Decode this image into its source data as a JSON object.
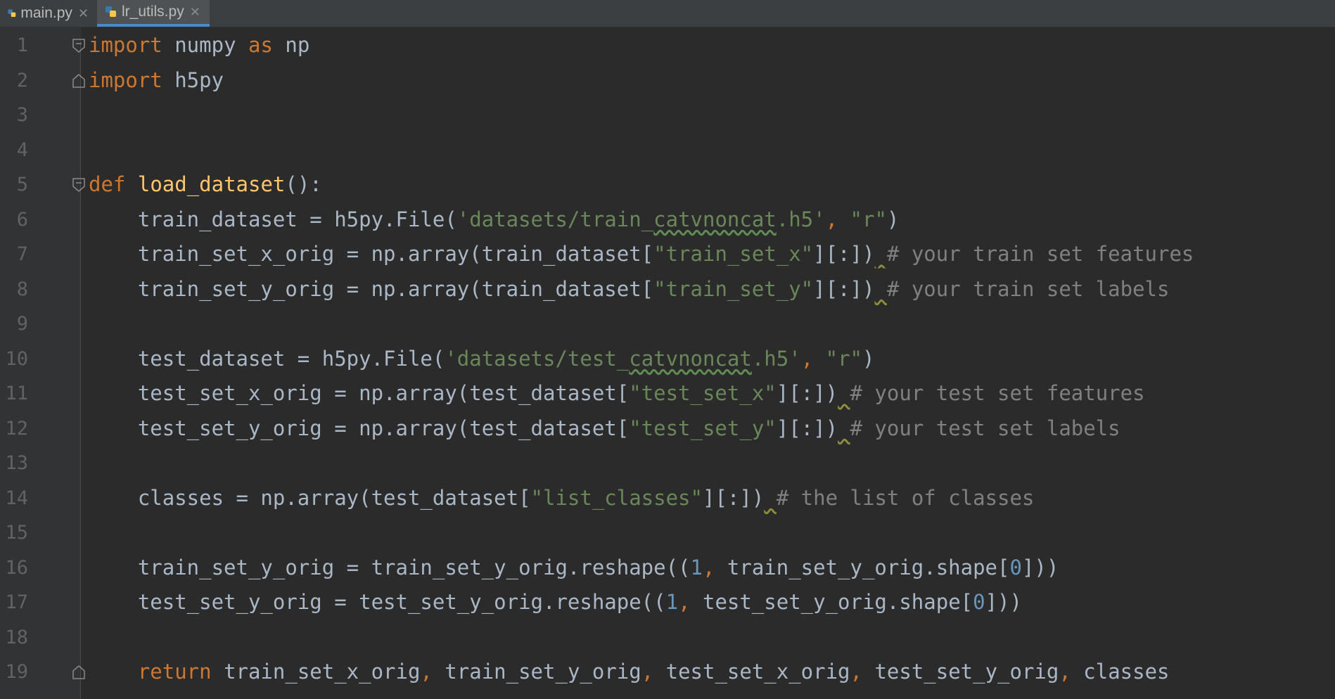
{
  "tabs": [
    {
      "label": "main.py",
      "active": false
    },
    {
      "label": "lr_utils.py",
      "active": true
    }
  ],
  "colors": {
    "background": "#2b2b2b",
    "keyword": "#cc7832",
    "function": "#ffc66d",
    "string": "#6a8759",
    "number": "#6897bb",
    "comment": "#808080",
    "text": "#a9b7c6",
    "active_tab_accent": "#4a88c7"
  },
  "icons": {
    "tab_file": "python-file-icon",
    "tab_close": "close-icon",
    "fold": "fold-marker-icon"
  },
  "editor": {
    "line_numbers": [
      "1",
      "2",
      "3",
      "4",
      "5",
      "6",
      "7",
      "8",
      "9",
      "10",
      "11",
      "12",
      "13",
      "14",
      "15",
      "16",
      "17",
      "18",
      "19"
    ],
    "lines": [
      {
        "fold": "start",
        "tokens": [
          {
            "t": "import",
            "c": "kw"
          },
          {
            "t": " numpy "
          },
          {
            "t": "as",
            "c": "kw"
          },
          {
            "t": " np"
          }
        ]
      },
      {
        "fold": "end",
        "tokens": [
          {
            "t": "import",
            "c": "kw"
          },
          {
            "t": " h5py"
          }
        ]
      },
      {
        "tokens": []
      },
      {
        "tokens": []
      },
      {
        "fold": "start",
        "tokens": [
          {
            "t": "def",
            "c": "kw"
          },
          {
            "t": " "
          },
          {
            "t": "load_dataset",
            "c": "fn"
          },
          {
            "t": "():"
          }
        ]
      },
      {
        "tokens": [
          {
            "t": "    train_dataset = h5py.File("
          },
          {
            "t": "'datasets/train_",
            "c": "str"
          },
          {
            "t": "catvnoncat",
            "c": "str typo"
          },
          {
            "t": ".h5'",
            "c": "str"
          },
          {
            "t": ", ",
            "c": "kw"
          },
          {
            "t": "\"r\"",
            "c": "str"
          },
          {
            "t": ")"
          }
        ]
      },
      {
        "tokens": [
          {
            "t": "    train_set_x_orig = np.array(train_dataset["
          },
          {
            "t": "\"train_set_x\"",
            "c": "str"
          },
          {
            "t": "][:])"
          },
          {
            "t": " ",
            "c": "warn"
          },
          {
            "t": "# your train set features",
            "c": "cm"
          }
        ]
      },
      {
        "tokens": [
          {
            "t": "    train_set_y_orig = np.array(train_dataset["
          },
          {
            "t": "\"train_set_y\"",
            "c": "str"
          },
          {
            "t": "][:])"
          },
          {
            "t": " ",
            "c": "warn"
          },
          {
            "t": "# your train set labels",
            "c": "cm"
          }
        ]
      },
      {
        "tokens": []
      },
      {
        "tokens": [
          {
            "t": "    test_dataset = h5py.File("
          },
          {
            "t": "'datasets/test_",
            "c": "str"
          },
          {
            "t": "catvnoncat",
            "c": "str typo"
          },
          {
            "t": ".h5'",
            "c": "str"
          },
          {
            "t": ", ",
            "c": "kw"
          },
          {
            "t": "\"r\"",
            "c": "str"
          },
          {
            "t": ")"
          }
        ]
      },
      {
        "tokens": [
          {
            "t": "    test_set_x_orig = np.array(test_dataset["
          },
          {
            "t": "\"test_set_x\"",
            "c": "str"
          },
          {
            "t": "][:])"
          },
          {
            "t": " ",
            "c": "warn"
          },
          {
            "t": "# your test set features",
            "c": "cm"
          }
        ]
      },
      {
        "tokens": [
          {
            "t": "    test_set_y_orig = np.array(test_dataset["
          },
          {
            "t": "\"test_set_y\"",
            "c": "str"
          },
          {
            "t": "][:])"
          },
          {
            "t": " ",
            "c": "warn"
          },
          {
            "t": "# your test set labels",
            "c": "cm"
          }
        ]
      },
      {
        "tokens": []
      },
      {
        "tokens": [
          {
            "t": "    classes = np.array(test_dataset["
          },
          {
            "t": "\"list_classes\"",
            "c": "str"
          },
          {
            "t": "][:])"
          },
          {
            "t": " ",
            "c": "warn"
          },
          {
            "t": "# the list of classes",
            "c": "cm"
          }
        ]
      },
      {
        "tokens": []
      },
      {
        "tokens": [
          {
            "t": "    train_set_y_orig = train_set_y_orig.reshape(("
          },
          {
            "t": "1",
            "c": "num"
          },
          {
            "t": ", ",
            "c": "kw"
          },
          {
            "t": "train_set_y_orig.shape["
          },
          {
            "t": "0",
            "c": "num"
          },
          {
            "t": "]))"
          }
        ]
      },
      {
        "tokens": [
          {
            "t": "    test_set_y_orig = test_set_y_orig.reshape(("
          },
          {
            "t": "1",
            "c": "num"
          },
          {
            "t": ", ",
            "c": "kw"
          },
          {
            "t": "test_set_y_orig.shape["
          },
          {
            "t": "0",
            "c": "num"
          },
          {
            "t": "]))"
          }
        ]
      },
      {
        "tokens": []
      },
      {
        "fold": "end",
        "tokens": [
          {
            "t": "    "
          },
          {
            "t": "return",
            "c": "kw"
          },
          {
            "t": " train_set_x_orig"
          },
          {
            "t": ", ",
            "c": "kw"
          },
          {
            "t": "train_set_y_orig"
          },
          {
            "t": ", ",
            "c": "kw"
          },
          {
            "t": "test_set_x_orig"
          },
          {
            "t": ", ",
            "c": "kw"
          },
          {
            "t": "test_set_y_orig"
          },
          {
            "t": ", ",
            "c": "kw"
          },
          {
            "t": "classes"
          }
        ]
      }
    ]
  }
}
